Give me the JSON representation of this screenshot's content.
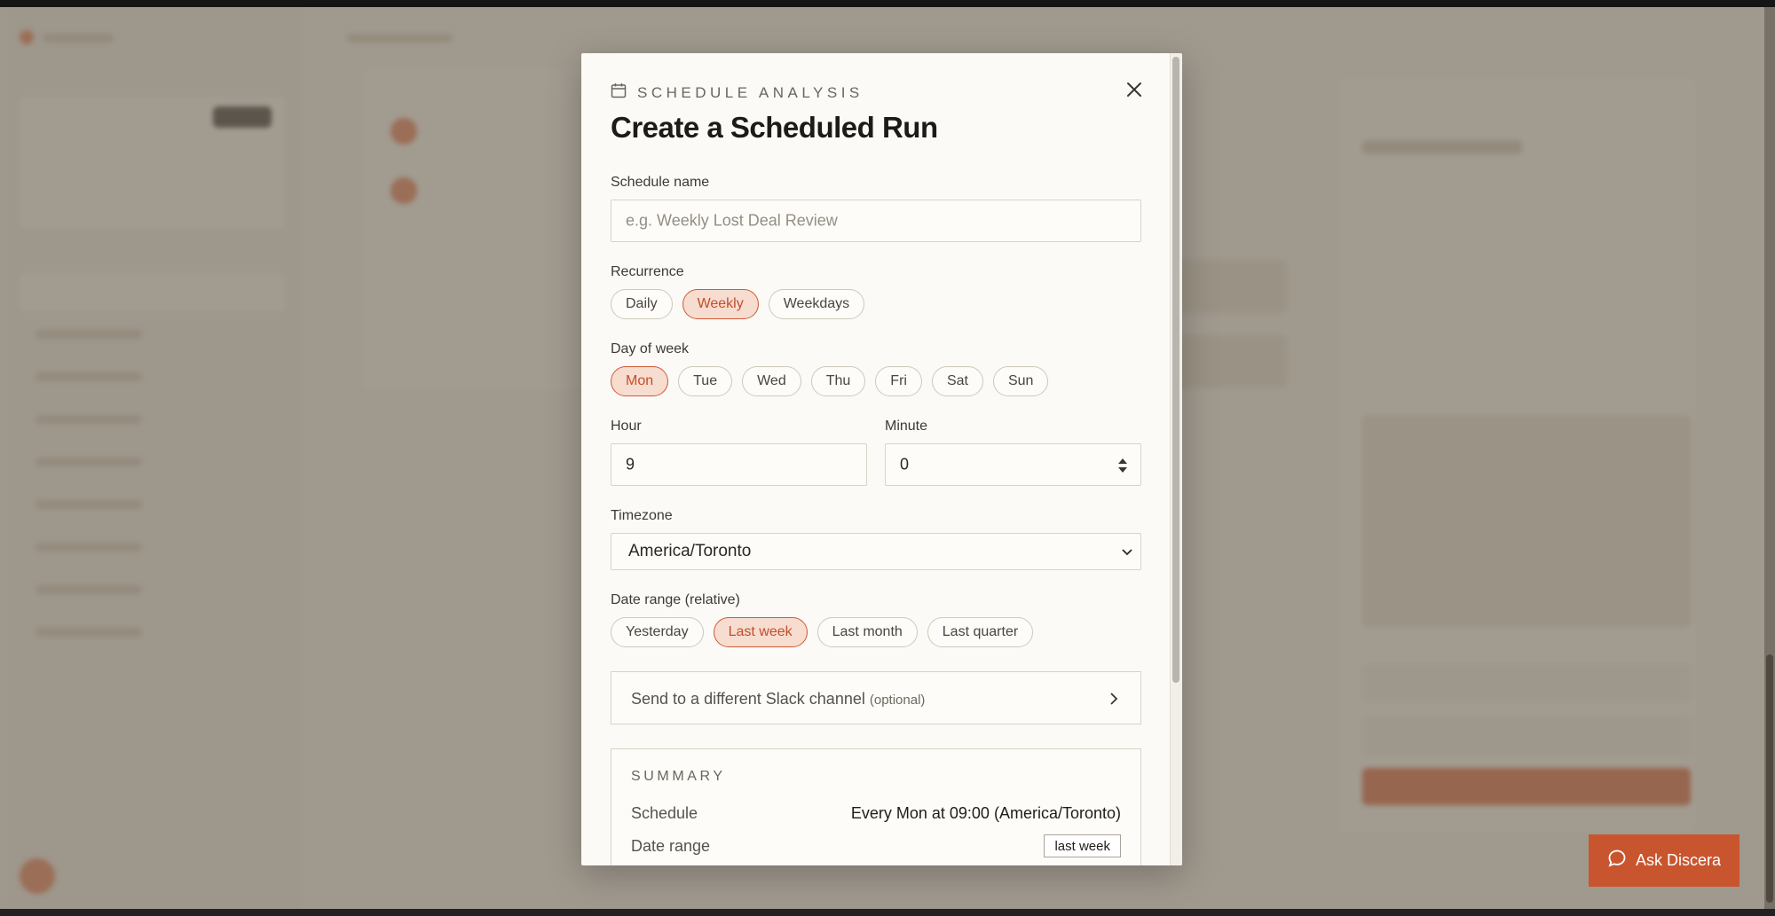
{
  "modal": {
    "eyebrow": "SCHEDULE ANALYSIS",
    "title": "Create a Scheduled Run",
    "schedule_name": {
      "label": "Schedule name",
      "placeholder": "e.g. Weekly Lost Deal Review",
      "value": ""
    },
    "recurrence": {
      "label": "Recurrence",
      "options": [
        "Daily",
        "Weekly",
        "Weekdays"
      ],
      "selected": "Weekly"
    },
    "day_of_week": {
      "label": "Day of week",
      "options": [
        "Mon",
        "Tue",
        "Wed",
        "Thu",
        "Fri",
        "Sat",
        "Sun"
      ],
      "selected": "Mon"
    },
    "hour": {
      "label": "Hour",
      "value": "9"
    },
    "minute": {
      "label": "Minute",
      "value": "0"
    },
    "timezone": {
      "label": "Timezone",
      "value": "America/Toronto"
    },
    "date_range": {
      "label": "Date range (relative)",
      "options": [
        "Yesterday",
        "Last week",
        "Last month",
        "Last quarter"
      ],
      "selected": "Last week"
    },
    "slack": {
      "label": "Send to a different Slack channel",
      "optional": "(optional)"
    },
    "summary": {
      "heading": "SUMMARY",
      "schedule_key": "Schedule",
      "schedule_value": "Every Mon at 09:00 (America/Toronto)",
      "date_range_key": "Date range",
      "date_range_value": "last week"
    }
  },
  "ask_button": {
    "label": "Ask Discera"
  },
  "colors": {
    "accent": "#c9552f",
    "accent_soft": "#f7dcd0",
    "modal_bg": "#fbfaf6",
    "overlay": "#70685a"
  },
  "icons": [
    "calendar-icon",
    "close-icon",
    "chevron-down-icon",
    "chevron-right-icon",
    "stepper-icon",
    "chat-bubble-icon"
  ]
}
